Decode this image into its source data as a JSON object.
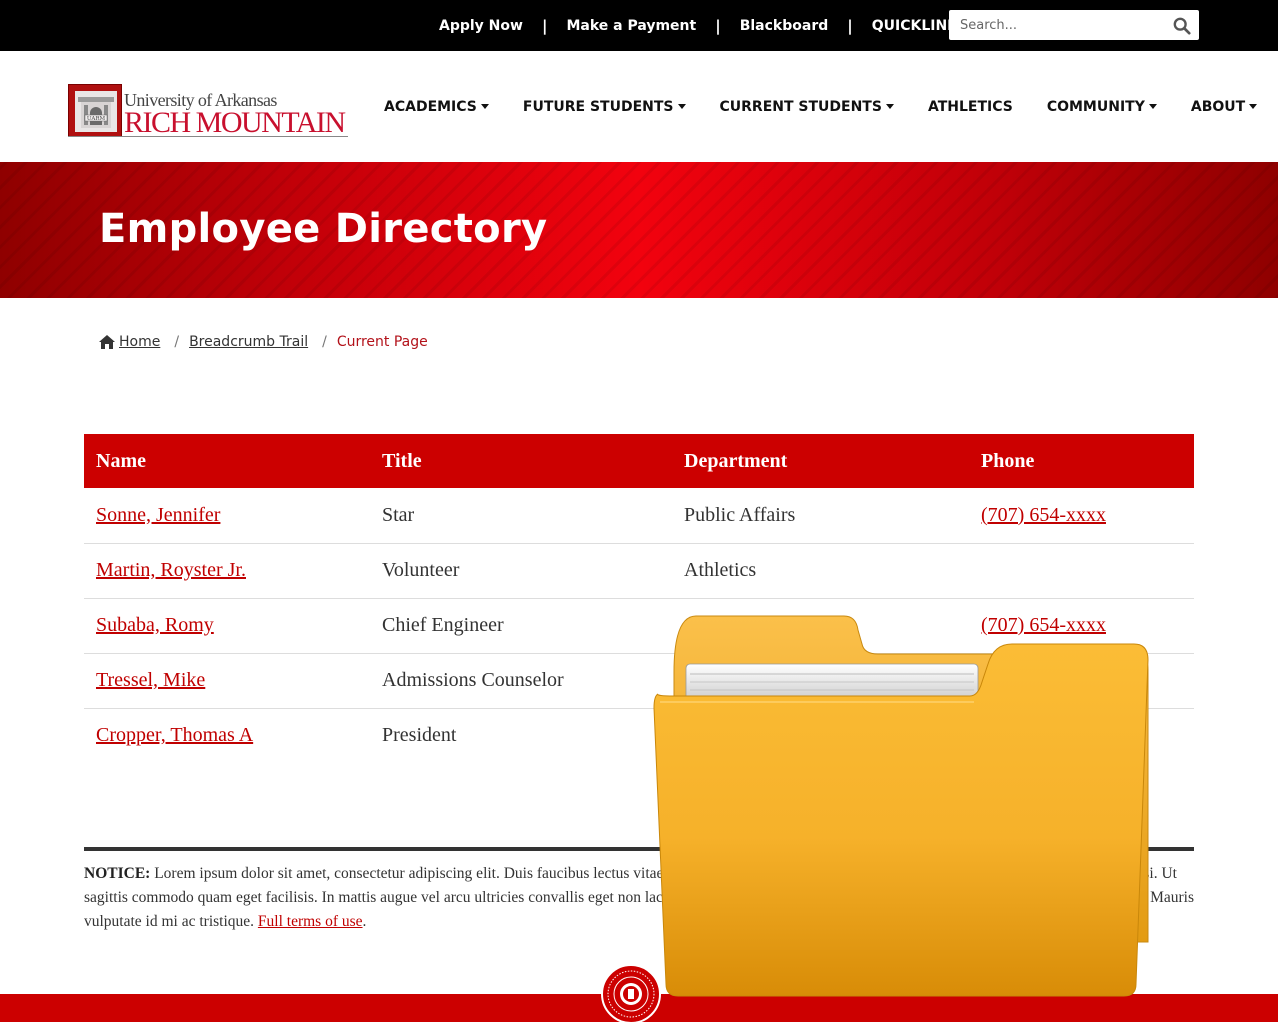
{
  "topbar": {
    "links": [
      "Apply Now",
      "Make a Payment",
      "Blackboard"
    ],
    "separator": "|",
    "quicklinks": "QUICKLINKS",
    "search_placeholder": "Search..."
  },
  "logo": {
    "line1": "University of Arkansas",
    "line2": "RICH MOUNTAIN",
    "badge": "UARM"
  },
  "nav": [
    "ACADEMICS",
    "FUTURE STUDENTS",
    "CURRENT STUDENTS",
    "ATHLETICS",
    "COMMUNITY",
    "ABOUT"
  ],
  "hero": {
    "title": "Employee Directory"
  },
  "breadcrumb": {
    "home": "Home",
    "trail": "Breadcrumb Trail",
    "current": "Current Page",
    "sep": "/"
  },
  "table": {
    "headers": [
      "Name",
      "Title",
      "Department",
      "Phone"
    ],
    "rows": [
      {
        "name": "Sonne, Jennifer",
        "title": "Star",
        "department": "Public Affairs",
        "phone": "(707) 654-xxxx"
      },
      {
        "name": "Martin, Royster Jr.",
        "title": "Volunteer",
        "department": "Athletics",
        "phone": ""
      },
      {
        "name": "Subaba, Romy",
        "title": "Chief Engineer",
        "department": "",
        "phone": "(707) 654-xxxx"
      },
      {
        "name": "Tressel, Mike",
        "title": "Admissions Counselor",
        "department": "",
        "phone": ""
      },
      {
        "name": "Cropper, Thomas A",
        "title": "President",
        "department": "",
        "phone": ""
      }
    ]
  },
  "notice": {
    "label": "NOTICE:",
    "text1": " Lorem ipsum dolor sit amet, consectetur adipiscing elit. Duis faucibus lectus vitae sa",
    "text1_end": "isi. Ut",
    "text2": "sagittis commodo quam eget facilisis. In mattis augue vel arcu ultricies convallis eget non lacus. I",
    "text2_end": "Mauris",
    "text3": "vulputate id mi ac tristique. ",
    "link": "Full terms of use",
    "end": "."
  },
  "colors": {
    "brand_red": "#cc0000",
    "accent_red": "#c00000",
    "folder": "#f7b52e"
  }
}
